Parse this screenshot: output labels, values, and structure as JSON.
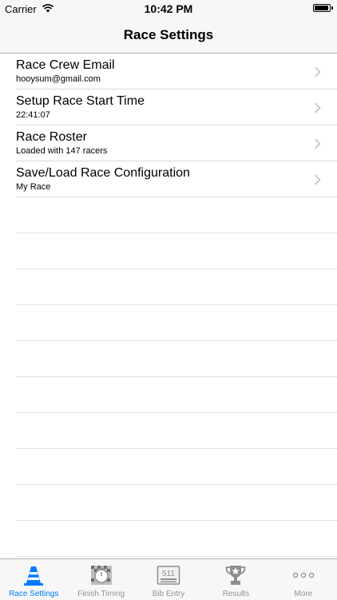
{
  "status_bar": {
    "carrier": "Carrier",
    "time": "10:42 PM",
    "battery_level": 0.95
  },
  "nav": {
    "title": "Race Settings"
  },
  "settings": [
    {
      "title": "Race Crew Email",
      "subtitle": "hooysum@gmail.com"
    },
    {
      "title": "Setup Race Start Time",
      "subtitle": "22:41:07"
    },
    {
      "title": "Race Roster",
      "subtitle": "Loaded with 147 racers"
    },
    {
      "title": "Save/Load Race Configuration",
      "subtitle": "My Race"
    }
  ],
  "tabs": [
    {
      "label": "Race Settings",
      "icon": "traffic-cone-icon",
      "active": true
    },
    {
      "label": "Finish Timing",
      "icon": "stopwatch-icon",
      "active": false
    },
    {
      "label": "Bib Entry",
      "icon": "bib-number-icon",
      "bib_text": "511",
      "active": false
    },
    {
      "label": "Results",
      "icon": "trophy-icon",
      "active": false
    },
    {
      "label": "More",
      "icon": "more-icon",
      "active": false
    }
  ],
  "colors": {
    "accent": "#007aff",
    "inactive": "#929292"
  }
}
